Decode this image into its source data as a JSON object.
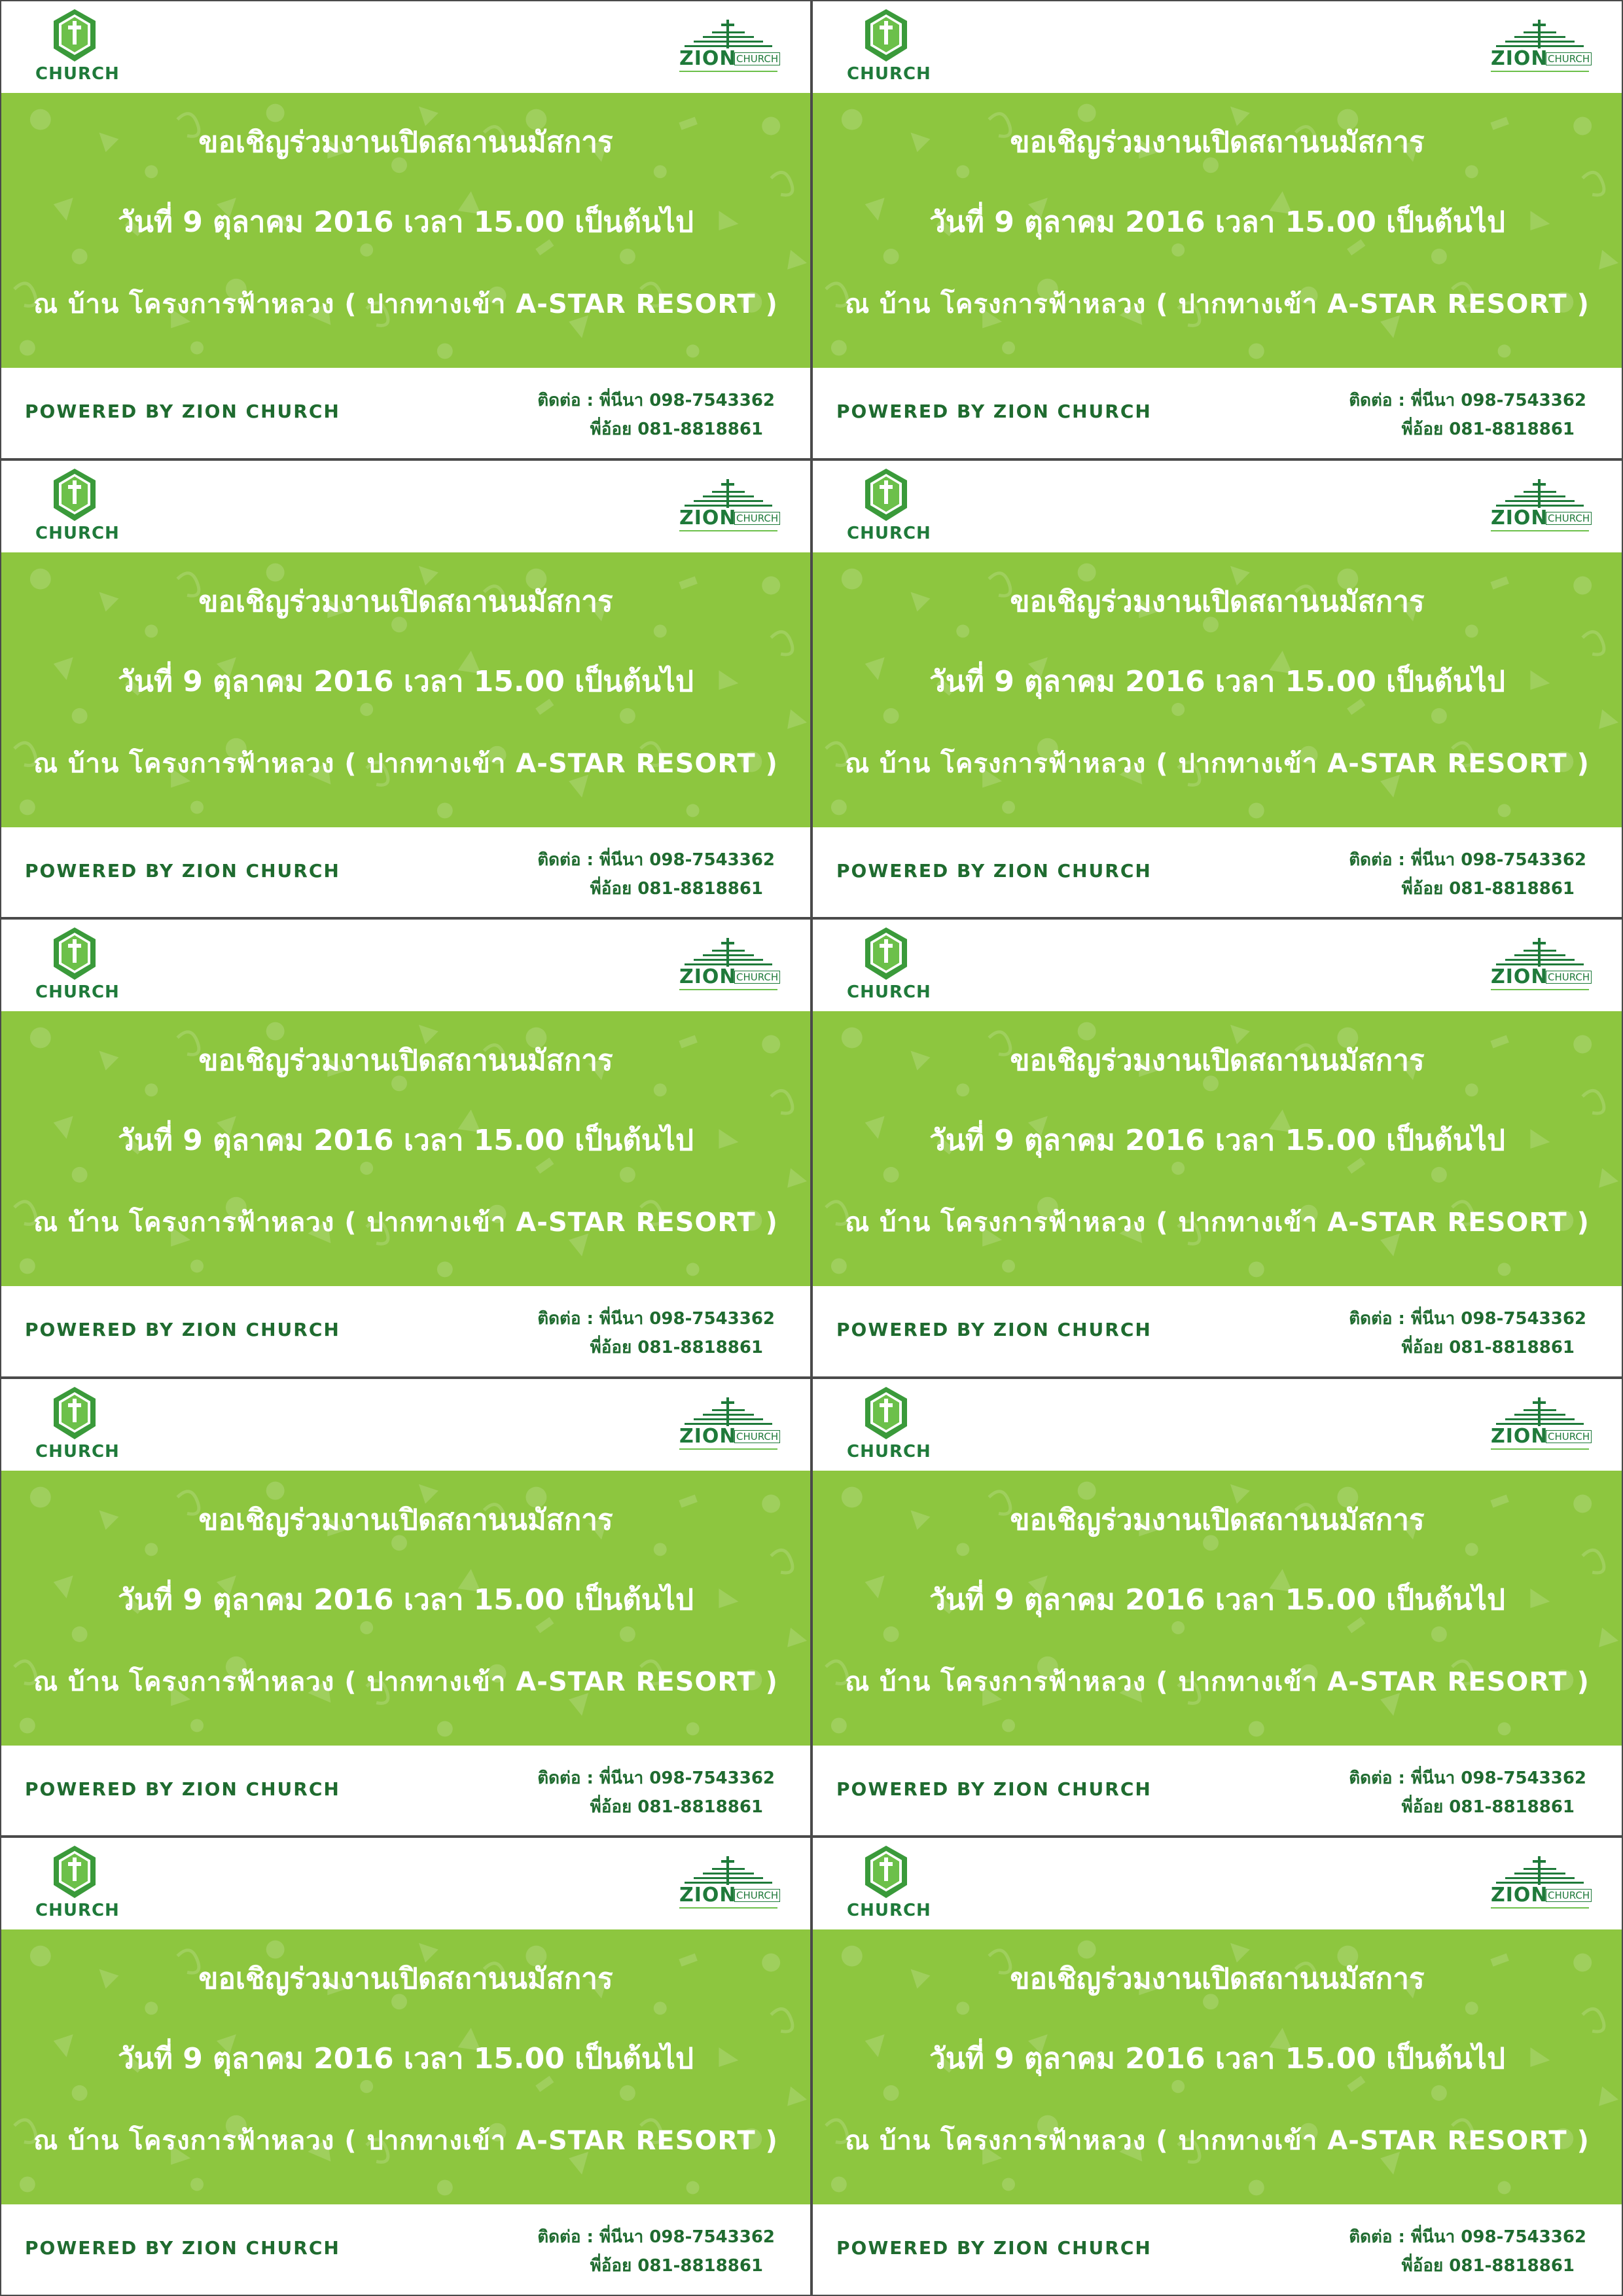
{
  "ticket": {
    "logo_left_text": "CHURCH",
    "logo_right_zion": "ZION",
    "logo_right_church": "CHURCH",
    "headline": "ขอเชิญร่วมงานเปิดสถานนมัสการ",
    "date_line": "วันที่ 9 ตุลาคม 2016 เวลา 15.00 เป็นต้นไป",
    "place_line": "ณ บ้าน โครงการฟ้าหลวง ( ปากทางเข้า A-STAR RESORT )",
    "powered_by": "POWERED BY ZION CHURCH",
    "contact_1": "ติดต่อ : พี่นีนา 098-7543362",
    "contact_2": "พี่อ้อย 081-8818861"
  },
  "colors": {
    "band": "#8dc63f",
    "brand_green": "#1f7a3a",
    "text_dark_green": "#1f6b2f",
    "border": "#4a4a4a"
  },
  "icons": {
    "left_logo": "church-hexagon-cross-icon",
    "right_logo": "zion-church-cross-icon"
  }
}
